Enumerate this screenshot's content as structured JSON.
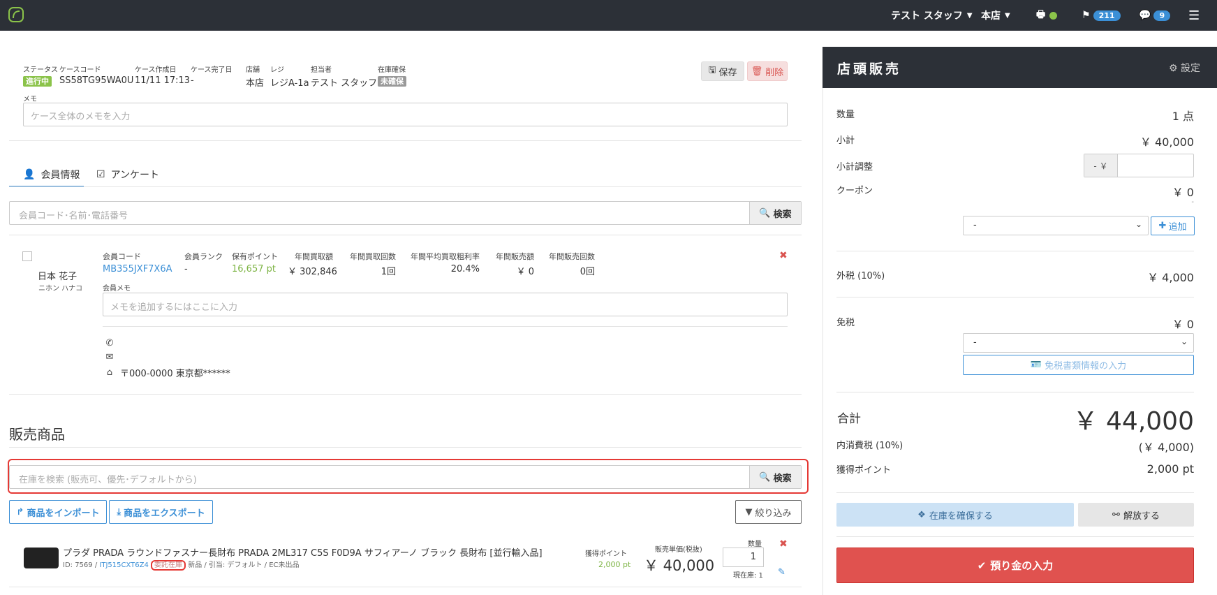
{
  "topbar": {
    "staff": "テスト スタッフ",
    "store": "本店",
    "flag_count": "211",
    "message_count": "9"
  },
  "case": {
    "status_label": "ステータス",
    "status": "進行中",
    "code_label": "ケースコード",
    "code": "SS58TG95WA0U",
    "created_label": "ケース作成日",
    "created": "11/11 17:13",
    "completed_label": "ケース完了日",
    "completed": "-",
    "store_label": "店舗",
    "store": "本店",
    "register_label": "レジ",
    "register": "レジA-1a",
    "staff_label": "担当者",
    "staff": "テスト スタッフ",
    "stock_label": "在庫確保",
    "stock": "未確保",
    "save_label": "保存",
    "delete_label": "削除",
    "memo_label": "メモ",
    "memo_placeholder": "ケース全体のメモを入力"
  },
  "tabs": {
    "member": "会員情報",
    "survey": "アンケート"
  },
  "member_search": {
    "placeholder": "会員コード･名前･電話番号",
    "button": "検索"
  },
  "member": {
    "name": "日本 花子",
    "kana": "ニホン ハナコ",
    "code_label": "会員コード",
    "code": "MB355JXF7X6A",
    "rank_label": "会員ランク",
    "rank": "-",
    "points_label": "保有ポイント",
    "points": "16,657 pt",
    "annual_buy_label": "年間買取額",
    "annual_buy": "￥ 302,846",
    "annual_buy_count_label": "年間買取回数",
    "annual_buy_count": "1回",
    "margin_label": "年間平均買取粗利率",
    "margin": "20.4%",
    "annual_sales_label": "年間販売額",
    "annual_sales": "￥ 0",
    "annual_sales_count_label": "年間販売回数",
    "annual_sales_count": "0回",
    "memo_label": "会員メモ",
    "memo_placeholder": "メモを追加するにはここに入力",
    "address": "〒000-0000 東京都******"
  },
  "sales": {
    "title": "販売商品",
    "search_placeholder": "在庫を検索 (販売可、優先･デフォルトから)",
    "search_button": "検索",
    "import_label": "商品をインポート",
    "export_label": "商品をエクスポート",
    "filter_label": "絞り込み"
  },
  "product": {
    "name": "プラダ PRADA ラウンドファスナー長財布 PRADA 2ML317 C5S F0D9A サフィアーノ ブラック 長財布 [並行輸入品]",
    "id_prefix": "ID: 7569 /",
    "item_code": "ITJ515CXT6Z4",
    "consign": "委託在庫",
    "meta_rest": "新品 / 引当: デフォルト / EC未出品",
    "points_label": "獲得ポイント",
    "points": "2,000 pt",
    "price_label": "販売単価(税抜)",
    "price": "￥ 40,000",
    "qty_label": "数量",
    "qty": "1",
    "stock": "現在庫: 1"
  },
  "panel": {
    "title": "店頭販売",
    "settings": "設定",
    "qty_label": "数量",
    "qty": "1 点",
    "subtotal_label": "小計",
    "subtotal": "￥ 40,000",
    "adjust_label": "小計調整",
    "adjust_prefix": "- ￥",
    "coupon_label": "クーポン",
    "coupon": "￥ 0",
    "coupon_dash": "-",
    "coupon_select": "-",
    "add_label": "追加",
    "tax_label": "外税 (10%)",
    "tax": "￥ 4,000",
    "exempt_label": "免税",
    "exempt": "￥ 0",
    "exempt_select": "-",
    "tax_doc_label": "免税書類情報の入力",
    "total_label": "合計",
    "total": "￥ 44,000",
    "inner_tax_label": "内消費税 (10%)",
    "inner_tax": "(￥ 4,000)",
    "points_label": "獲得ポイント",
    "points": "2,000 pt",
    "secure_label": "在庫を確保する",
    "release_label": "解放する",
    "deposit_label": "預り金の入力"
  }
}
